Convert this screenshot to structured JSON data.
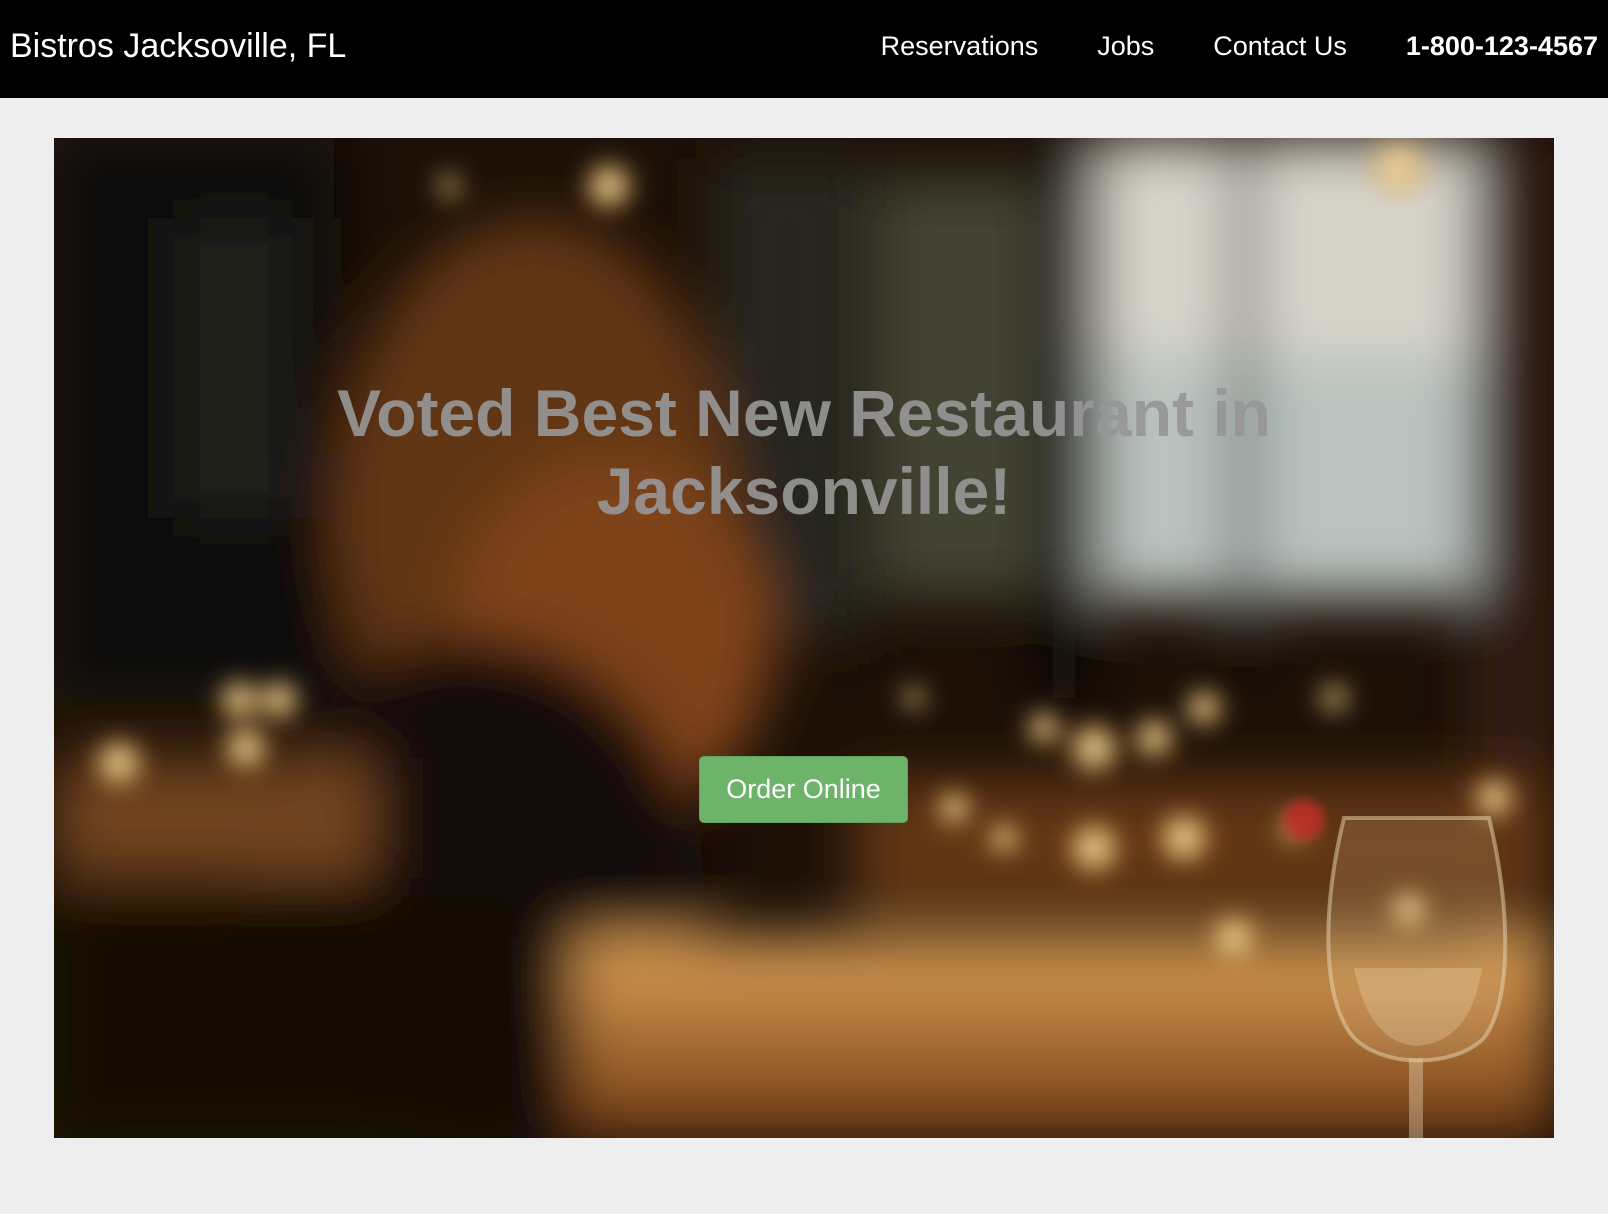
{
  "navbar": {
    "brand": "Bistros Jacksoville, FL",
    "links": [
      {
        "label": "Reservations"
      },
      {
        "label": "Jobs"
      },
      {
        "label": "Contact Us"
      }
    ],
    "phone": "1-800-123-4567"
  },
  "hero": {
    "headline": "Voted Best New Restaurant in Jacksonville!",
    "cta_label": "Order Online",
    "image_description_icon": "blurred-restaurant-photo",
    "cta_color": "#6db36a"
  }
}
